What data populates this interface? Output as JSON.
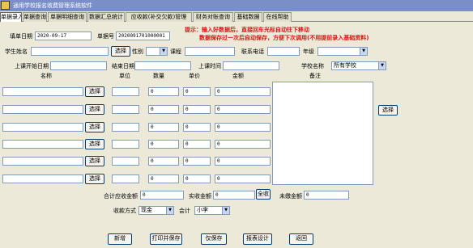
{
  "window": {
    "title": "通用学校报名收费管理系统软件"
  },
  "tabs": [
    "单据录入",
    "单据查询",
    "单据明细查询",
    "数据汇总统计",
    "应收款(补交欠款)管理",
    "财务对账查询",
    "基础数据",
    "在线帮助"
  ],
  "header": {
    "date_label": "填单日期",
    "date_value": "2020-09-17",
    "no_label": "单据号",
    "no_value": "2020091701000001",
    "tip_line1": "提示：输入好数据后，直接回车光标自动往下移动",
    "tip_line2": "数据保存过一次后自动保存，方便下次调用(不用提前录入基础资料)"
  },
  "student": {
    "name_label": "学生姓名",
    "select_label": "选择",
    "gender_label": "性别",
    "course_label": "课程",
    "phone_label": "联系电话",
    "grade_label": "年级",
    "start_date_label": "上课开始日期",
    "end_date_label": "结束日期",
    "time_label": "上课时间",
    "school_label": "学校名称",
    "school_value": "所有学校"
  },
  "items": {
    "columns": [
      "名称",
      "单位",
      "数量",
      "单价",
      "金额",
      "备注"
    ],
    "select_label": "选择",
    "rows": [
      {
        "qty": "0",
        "price": "0",
        "amount": "0"
      },
      {
        "qty": "0",
        "price": "0",
        "amount": "0"
      },
      {
        "qty": "0",
        "price": "0",
        "amount": "0"
      },
      {
        "qty": "0",
        "price": "0",
        "amount": "0"
      },
      {
        "qty": "0",
        "price": "0",
        "amount": "0"
      },
      {
        "qty": "0",
        "price": "0",
        "amount": "0"
      }
    ],
    "remark_select_label": "选择"
  },
  "totals": {
    "receivable_label": "合计应收金额",
    "receivable_value": "0",
    "paid_label": "实收金额",
    "paid_value": "0",
    "full_button": "全收",
    "unpaid_label": "未缴金额",
    "unpaid_value": "0",
    "method_label": "收款方式",
    "method_value": "现金",
    "accountant_label": "会计",
    "accountant_value": "小李"
  },
  "buttons": {
    "new": "新增",
    "print_save": "打印并保存",
    "save_only": "仅保存",
    "report": "报表设计",
    "back": "返回"
  }
}
